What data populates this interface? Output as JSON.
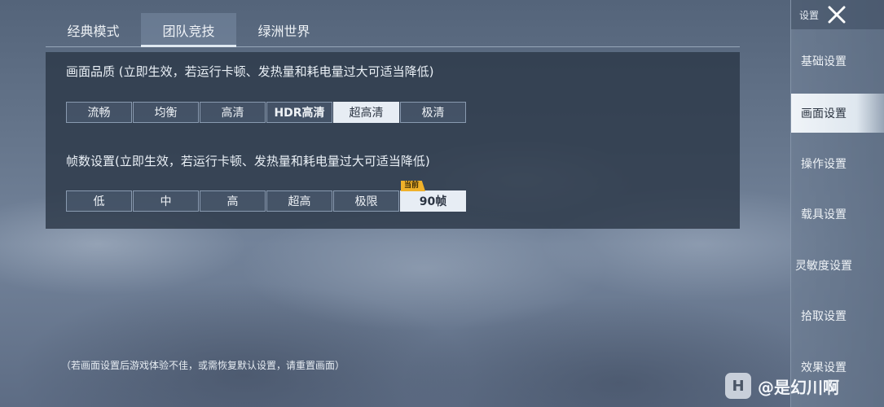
{
  "tabs": [
    "经典模式",
    "团队竞技",
    "绿洲世界"
  ],
  "graphics": {
    "quality_title": "画面品质 (立即生效，若运行卡顿、发热量和耗电量过大可适当降低)",
    "quality_options": [
      "流畅",
      "均衡",
      "高清",
      "HDR高清",
      "超高清",
      "极清"
    ],
    "quality_selected": "超高清",
    "fps_title": "帧数设置(立即生效，若运行卡顿、发热量和耗电量过大可适当降低)",
    "fps_options": [
      "低",
      "中",
      "高",
      "超高",
      "极限",
      "90帧"
    ],
    "fps_selected": "90帧",
    "fps_current_badge": "当前"
  },
  "footnote": "（若画面设置后游戏体验不佳，或需恢复默认设置，请重置画面）",
  "sidebar": {
    "header": "设置",
    "close_icon": "close-x-icon",
    "items": [
      "基础设置",
      "画面设置",
      "操作设置",
      "载具设置",
      "灵敏度设置",
      "拾取设置",
      "效果设置"
    ],
    "active": "画面设置"
  },
  "watermark": {
    "logo": "H",
    "text": "@是幻川啊"
  }
}
